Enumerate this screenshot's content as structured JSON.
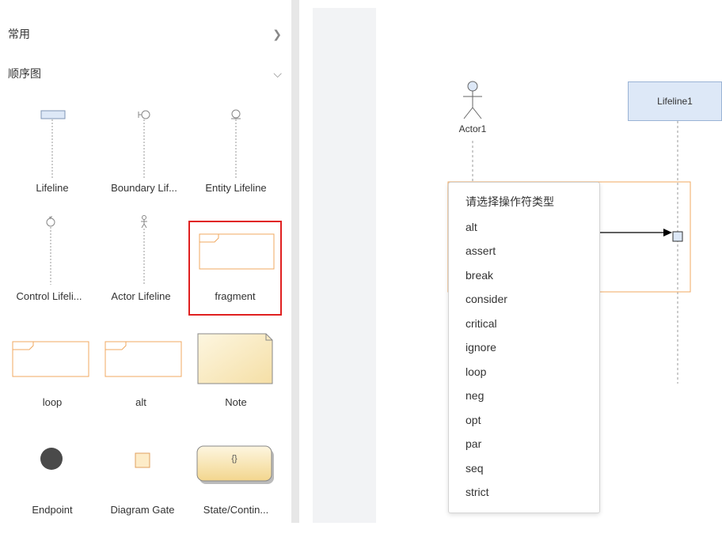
{
  "sidebar": {
    "sections": [
      {
        "title": "常用",
        "expanded": false
      },
      {
        "title": "顺序图",
        "expanded": true
      }
    ],
    "shapes": [
      {
        "label": "Lifeline"
      },
      {
        "label": "Boundary Lif..."
      },
      {
        "label": "Entity Lifeline"
      },
      {
        "label": "Control Lifeli..."
      },
      {
        "label": "Actor Lifeline"
      },
      {
        "label": "fragment",
        "selected": true
      },
      {
        "label": "loop"
      },
      {
        "label": "alt"
      },
      {
        "label": "Note"
      },
      {
        "label": "Endpoint"
      },
      {
        "label": "Diagram Gate"
      },
      {
        "label": "State/Contin..."
      }
    ],
    "icons": {
      "collapsed_chevron": "chevron-right-icon",
      "expanded_chevron": "chevron-down-icon"
    }
  },
  "canvas": {
    "actor": {
      "label": "Actor1"
    },
    "lifeline": {
      "label": "Lifeline1"
    }
  },
  "operator_popup": {
    "title": "请选择操作符类型",
    "items": [
      "alt",
      "assert",
      "break",
      "consider",
      "critical",
      "ignore",
      "loop",
      "neg",
      "opt",
      "par",
      "seq",
      "strict"
    ]
  },
  "colors": {
    "selection_border": "#e02020",
    "fragment_border": "#f0a860",
    "lifeline_fill": "#dde8f7",
    "note_fill": "#fdf3d6"
  }
}
